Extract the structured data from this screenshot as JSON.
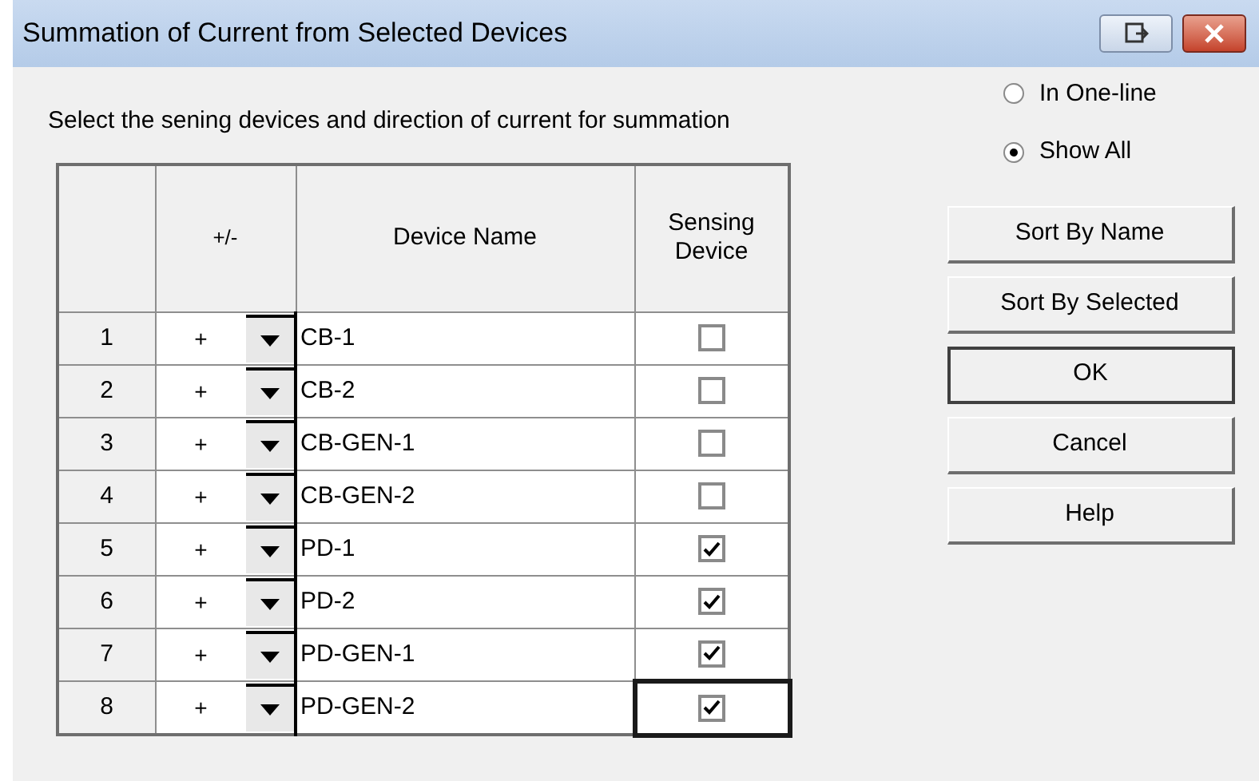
{
  "window": {
    "title": "Summation of Current from Selected Devices"
  },
  "instruction": "Select the sening devices and direction of current for summation",
  "table": {
    "columns": [
      "",
      "+/-",
      "Device Name",
      "Sensing Device"
    ],
    "rows": [
      {
        "index": "1",
        "sign": "+",
        "device": "CB-1",
        "sensing": false,
        "focused": false
      },
      {
        "index": "2",
        "sign": "+",
        "device": "CB-2",
        "sensing": false,
        "focused": false
      },
      {
        "index": "3",
        "sign": "+",
        "device": "CB-GEN-1",
        "sensing": false,
        "focused": false
      },
      {
        "index": "4",
        "sign": "+",
        "device": "CB-GEN-2",
        "sensing": false,
        "focused": false
      },
      {
        "index": "5",
        "sign": "+",
        "device": "PD-1",
        "sensing": true,
        "focused": false
      },
      {
        "index": "6",
        "sign": "+",
        "device": "PD-2",
        "sensing": true,
        "focused": false
      },
      {
        "index": "7",
        "sign": "+",
        "device": "PD-GEN-1",
        "sensing": true,
        "focused": false
      },
      {
        "index": "8",
        "sign": "+",
        "device": "PD-GEN-2",
        "sensing": true,
        "focused": true
      }
    ]
  },
  "view_options": [
    {
      "label": "In One-line",
      "selected": false
    },
    {
      "label": "Show All",
      "selected": true
    }
  ],
  "buttons": [
    {
      "label": "Sort By Name",
      "default": false
    },
    {
      "label": "Sort By Selected",
      "default": false
    },
    {
      "label": "OK",
      "default": true
    },
    {
      "label": "Cancel",
      "default": false
    },
    {
      "label": "Help",
      "default": false
    }
  ]
}
